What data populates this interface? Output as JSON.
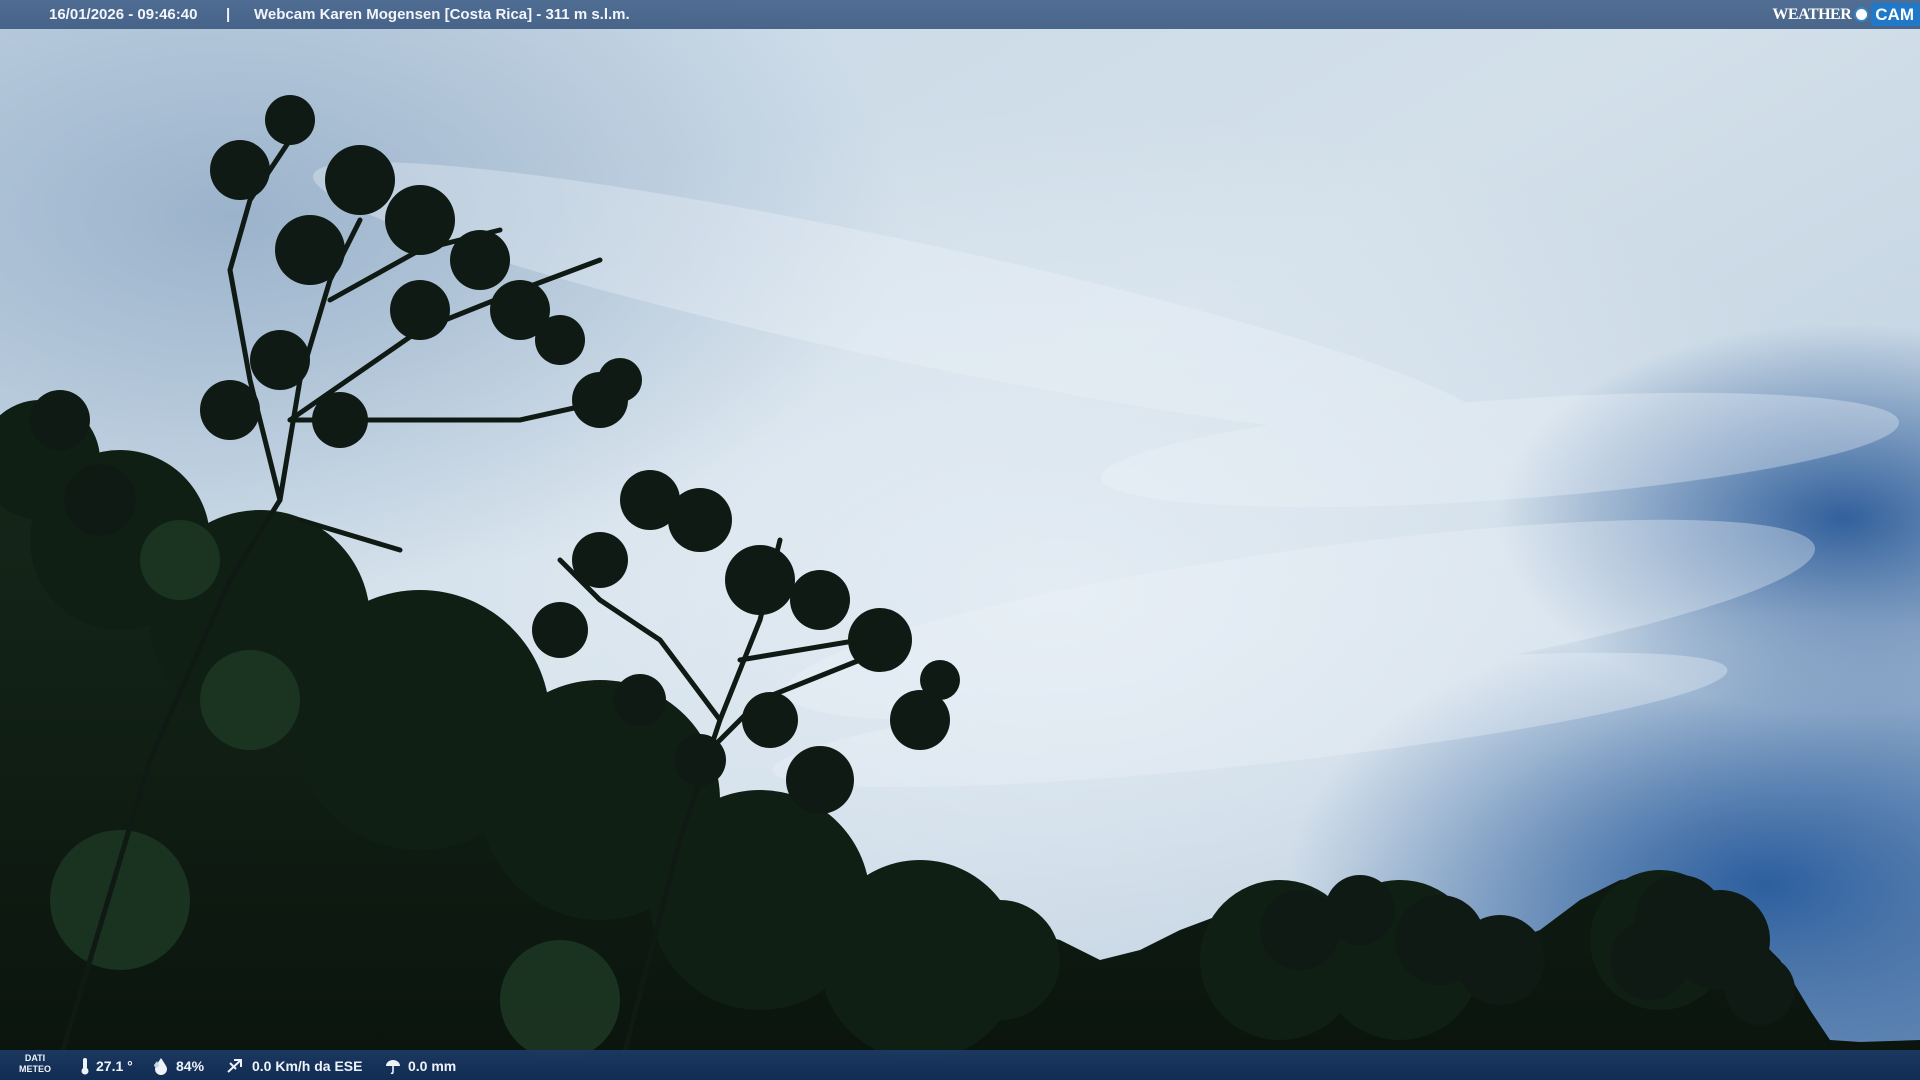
{
  "header": {
    "datetime": "16/01/2026 - 09:46:40",
    "separator": "|",
    "title": "Webcam Karen Mogensen [Costa Rica]  - 311 m s.l.m."
  },
  "logo": {
    "word": "WEATHER",
    "cam": "CAM"
  },
  "weather": {
    "label_line1": "DATI",
    "label_line2": "METEO",
    "temperature": "27.1 °",
    "humidity": "84%",
    "wind": "0.0 Km/h da ESE",
    "rain": "0.0 mm"
  },
  "colors": {
    "sky_top": "#b8cde0",
    "sky_blue": "#2f5f9a",
    "foliage": "#0f1d13",
    "bar": "#1c3a64"
  },
  "icons": [
    "thermometer-icon",
    "humidity-drop-icon",
    "wind-icon",
    "rain-icon"
  ]
}
